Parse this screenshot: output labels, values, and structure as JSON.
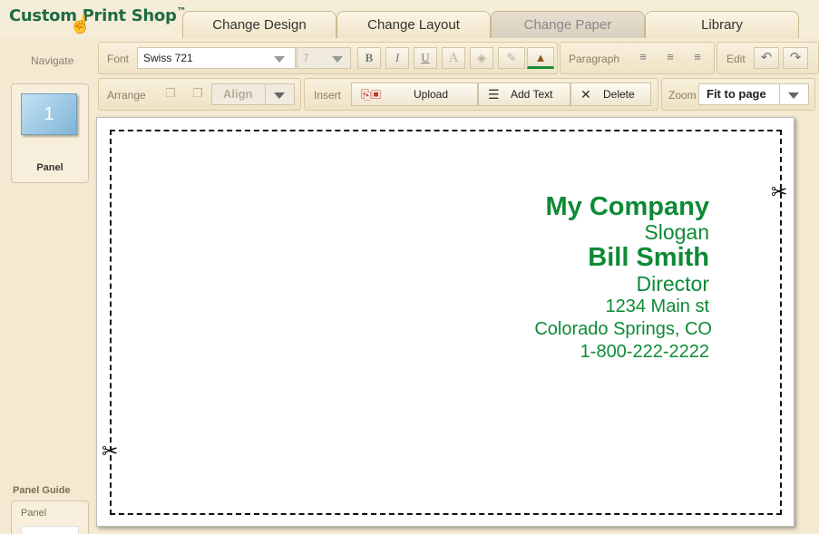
{
  "app": {
    "logo": "Custom Print Shop",
    "logo_mark": "™"
  },
  "tabs": [
    {
      "label": "Change Design"
    },
    {
      "label": "Change Layout"
    },
    {
      "label": "Change Paper",
      "active": true
    },
    {
      "label": "Library"
    }
  ],
  "left": {
    "navigate": "Navigate",
    "panel_number": "1",
    "panel_label": "Panel",
    "panel_guide": "Panel Guide",
    "panel_guide_item": "Panel"
  },
  "toolbar": {
    "font": {
      "label": "Font",
      "family": "Swiss 721",
      "size": "7",
      "bold": "B",
      "italic": "I",
      "underline": "U",
      "text_color": "A"
    },
    "paragraph": {
      "label": "Paragraph"
    },
    "edit": {
      "label": "Edit",
      "undo": "↶",
      "redo": "↷"
    },
    "arrange": {
      "label": "Arrange",
      "align": "Align"
    },
    "insert": {
      "label": "Insert",
      "upload": "Upload",
      "add_text": "Add Text",
      "delete": "Delete"
    },
    "zoom": {
      "label": "Zoom",
      "value": "Fit to page"
    }
  },
  "card": {
    "company": "My Company",
    "slogan": "Slogan",
    "name": "Bill Smith",
    "title": "Director",
    "street": "1234 Main st",
    "city": "Colorado Springs, CO",
    "phone": "1-800-222-2222"
  },
  "colors": {
    "brand": "#1e6b45",
    "card_text": "#0d8a35",
    "panel_bg": "#f4ead2"
  }
}
